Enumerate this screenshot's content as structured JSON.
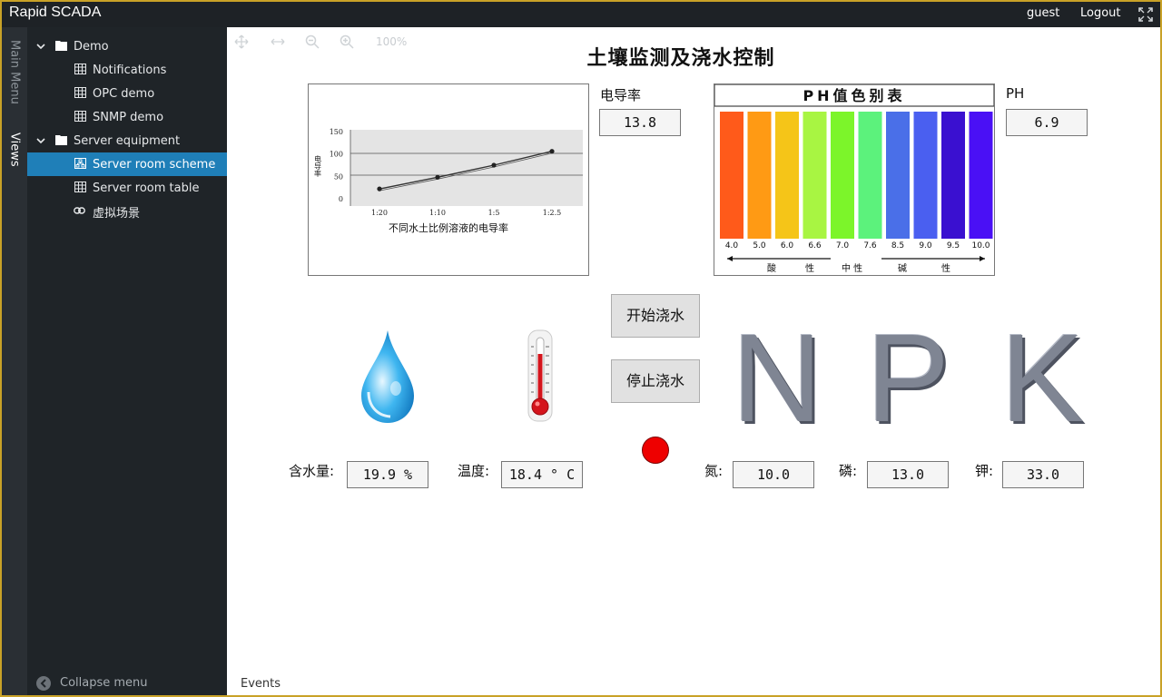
{
  "app": {
    "title": "Rapid SCADA",
    "user": "guest",
    "logout": "Logout"
  },
  "tabs": {
    "main_menu": "Main Menu",
    "views": "Views"
  },
  "sidebar": {
    "items": [
      {
        "label": "Demo",
        "kind": "folder",
        "expanded": true
      },
      {
        "label": "Notifications",
        "kind": "table"
      },
      {
        "label": "OPC demo",
        "kind": "table"
      },
      {
        "label": "SNMP demo",
        "kind": "table"
      },
      {
        "label": "Server equipment",
        "kind": "folder",
        "expanded": true
      },
      {
        "label": "Server room scheme",
        "kind": "scheme",
        "selected": true
      },
      {
        "label": "Server room table",
        "kind": "table"
      },
      {
        "label": "虚拟场景",
        "kind": "link"
      }
    ],
    "collapse_label": "Collapse menu"
  },
  "toolbar": {
    "zoom_level": "100%"
  },
  "scheme": {
    "title": "土壤监测及浇水控制",
    "conductivity": {
      "label": "电导率",
      "value": "13.8"
    },
    "ph": {
      "label": "PH",
      "value": "6.9"
    },
    "buttons": {
      "start": "开始浇水",
      "stop": "停止浇水"
    },
    "status_led_color": "#ee0000",
    "npk_letters": [
      "N",
      "P",
      "K"
    ],
    "moisture": {
      "label": "含水量:",
      "value": "19.9 %"
    },
    "temperature": {
      "label": "温度:",
      "value": "18.4 ° C"
    },
    "nitrogen": {
      "label": "氮:",
      "value": "10.0"
    },
    "phosphorus": {
      "label": "磷:",
      "value": "13.0"
    },
    "potassium": {
      "label": "钾:",
      "value": "33.0"
    }
  },
  "cond_chart": {
    "ylabel": "电导率",
    "yticks": [
      "150",
      "100",
      "50",
      "0"
    ],
    "xticks": [
      "1:20",
      "1:10",
      "1:5",
      "1:2.5"
    ],
    "caption": "不同水土比例溶液的电导率",
    "series_values": [
      22,
      48,
      75,
      106
    ]
  },
  "ph_chart": {
    "title": "PH值色别表",
    "colors": [
      "#ff5a1a",
      "#ff9a14",
      "#f5c518",
      "#a8f542",
      "#7cf52a",
      "#5cf27c",
      "#4a6fe8",
      "#4a5ff0",
      "#3a10d0",
      "#4a10f5"
    ],
    "scale": [
      "4.0",
      "5.0",
      "6.0",
      "6.6",
      "7.0",
      "7.6",
      "8.5",
      "9.0",
      "9.5",
      "10.0"
    ],
    "legend": {
      "acid_1": "酸",
      "acid_2": "性",
      "neutral": "中 性",
      "base_1": "碱",
      "base_2": "性"
    }
  },
  "footer": {
    "events": "Events"
  }
}
